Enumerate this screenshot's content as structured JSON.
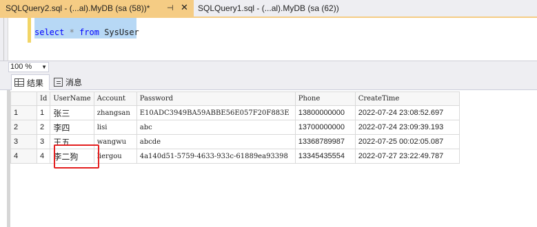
{
  "tabs": [
    {
      "title": "SQLQuery2.sql - (...al).MyDB (sa (58))*",
      "active": true
    },
    {
      "title": "SQLQuery1.sql - (...al).MyDB (sa (62))",
      "active": false
    }
  ],
  "tab_icons": {
    "pin": "pin-icon",
    "close": "close-icon"
  },
  "editor": {
    "keyword_select": "select",
    "star": "*",
    "keyword_from": "from",
    "table": "SysUser"
  },
  "zoom": {
    "value": "100 %"
  },
  "result_tabs": [
    {
      "label": "结果",
      "icon": "grid-icon",
      "active": true
    },
    {
      "label": "消息",
      "icon": "message-icon",
      "active": false
    }
  ],
  "grid": {
    "columns": [
      "Id",
      "UserName",
      "Account",
      "Password",
      "Phone",
      "CreateTime"
    ],
    "rows": [
      {
        "num": "1",
        "id": "1",
        "username": "张三",
        "account": "zhangsan",
        "password": "E10ADC3949BA59ABBE56E057F20F883E",
        "phone": "13800000000",
        "createtime": "2022-07-24 23:08:52.697"
      },
      {
        "num": "2",
        "id": "2",
        "username": "李四",
        "account": "lisi",
        "password": "abc",
        "phone": "13700000000",
        "createtime": "2022-07-24 23:09:39.193"
      },
      {
        "num": "3",
        "id": "3",
        "username": "王五",
        "account": "wangwu",
        "password": "abcde",
        "phone": "13368789987",
        "createtime": "2022-07-25 00:02:05.087"
      },
      {
        "num": "4",
        "id": "4",
        "username": "李二狗",
        "account": "liergou",
        "password": "4a140d51-5759-4633-933c-61889ea93398",
        "phone": "13345435554",
        "createtime": "2022-07-27 23:22:49.787"
      }
    ]
  },
  "colors": {
    "active_tab": "#f5cc84",
    "highlight": "#e41e1e",
    "keyword": "#0000ff",
    "selection": "#b7d8f5"
  }
}
